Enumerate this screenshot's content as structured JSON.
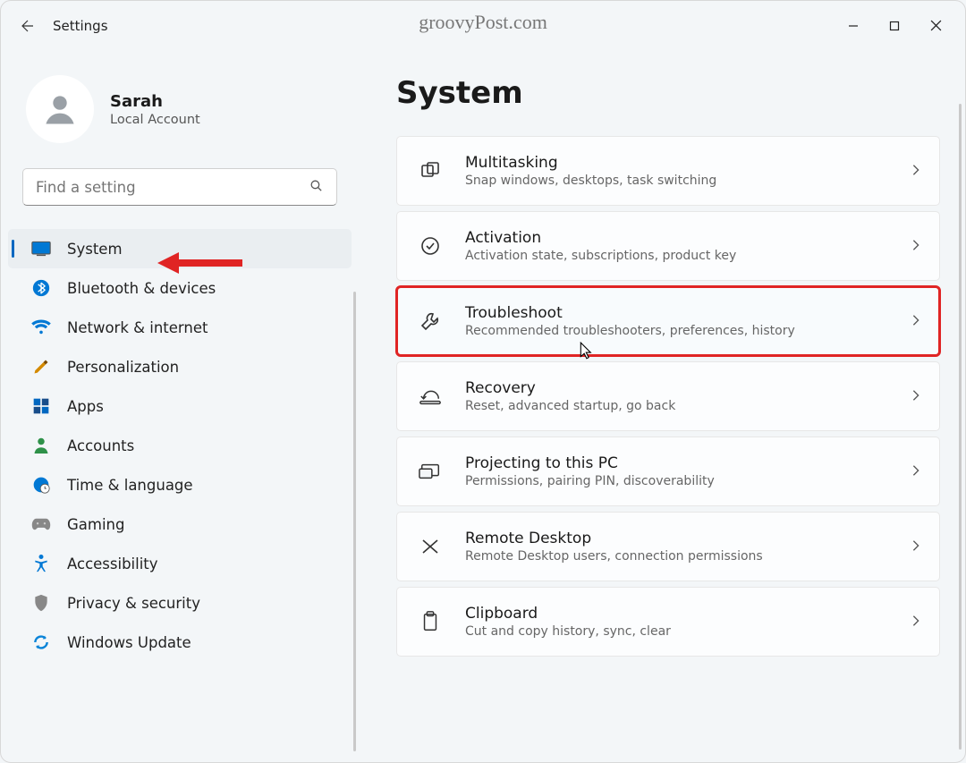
{
  "app": {
    "title": "Settings"
  },
  "watermark": "groovyPost.com",
  "profile": {
    "name": "Sarah",
    "sub": "Local Account"
  },
  "search": {
    "placeholder": "Find a setting"
  },
  "sidebar": {
    "items": [
      {
        "id": "system",
        "label": "System",
        "selected": true
      },
      {
        "id": "bluetooth",
        "label": "Bluetooth & devices"
      },
      {
        "id": "network",
        "label": "Network & internet"
      },
      {
        "id": "personalization",
        "label": "Personalization"
      },
      {
        "id": "apps",
        "label": "Apps"
      },
      {
        "id": "accounts",
        "label": "Accounts"
      },
      {
        "id": "time",
        "label": "Time & language"
      },
      {
        "id": "gaming",
        "label": "Gaming"
      },
      {
        "id": "accessibility",
        "label": "Accessibility"
      },
      {
        "id": "privacy",
        "label": "Privacy & security"
      },
      {
        "id": "update",
        "label": "Windows Update"
      }
    ]
  },
  "page": {
    "title": "System"
  },
  "cards": [
    {
      "id": "multitasking",
      "title": "Multitasking",
      "sub": "Snap windows, desktops, task switching"
    },
    {
      "id": "activation",
      "title": "Activation",
      "sub": "Activation state, subscriptions, product key"
    },
    {
      "id": "troubleshoot",
      "title": "Troubleshoot",
      "sub": "Recommended troubleshooters, preferences, history",
      "highlight": true
    },
    {
      "id": "recovery",
      "title": "Recovery",
      "sub": "Reset, advanced startup, go back"
    },
    {
      "id": "projecting",
      "title": "Projecting to this PC",
      "sub": "Permissions, pairing PIN, discoverability"
    },
    {
      "id": "remotedesktop",
      "title": "Remote Desktop",
      "sub": "Remote Desktop users, connection permissions"
    },
    {
      "id": "clipboard",
      "title": "Clipboard",
      "sub": "Cut and copy history, sync, clear"
    }
  ]
}
